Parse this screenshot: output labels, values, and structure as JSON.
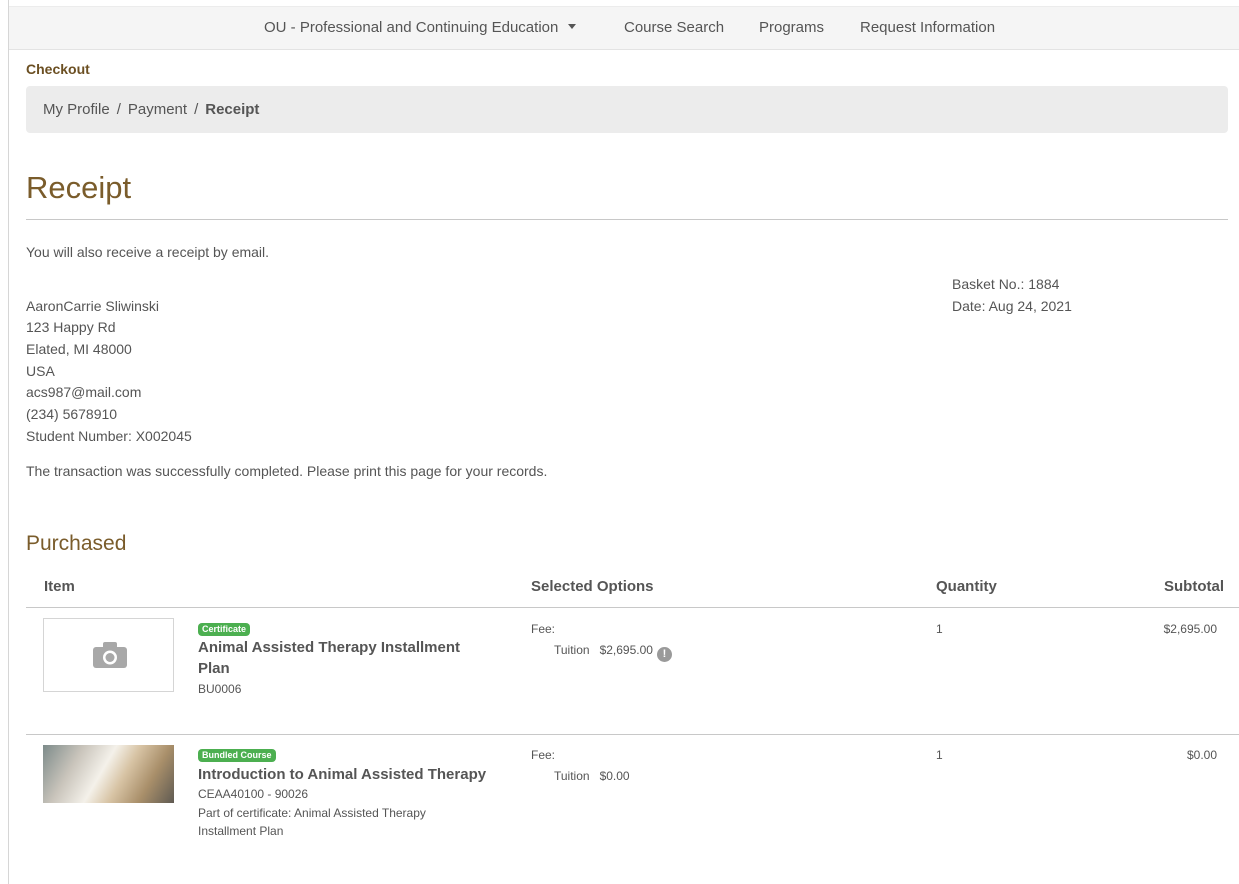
{
  "nav": {
    "brand": "OU - Professional and Continuing Education",
    "links": [
      "Course Search",
      "Programs",
      "Request Information"
    ]
  },
  "checkout_title": "Checkout",
  "breadcrumb": {
    "items": [
      "My Profile",
      "Payment"
    ],
    "separator": "/",
    "current": "Receipt"
  },
  "page_title": "Receipt",
  "email_note": "You will also receive a receipt by email.",
  "customer": {
    "name": "AaronCarrie Sliwinski",
    "street": "123 Happy Rd",
    "city_line": "Elated, MI 48000",
    "country": "USA",
    "email": "acs987@mail.com",
    "phone": "(234) 5678910",
    "student_number": "Student Number: X002045"
  },
  "basket": {
    "number": "Basket No.: 1884",
    "date": "Date: Aug 24, 2021"
  },
  "confirmation": "The transaction was successfully completed. Please print this page for your records.",
  "purchased": {
    "title": "Purchased",
    "columns": [
      "Item",
      "Selected Options",
      "Quantity",
      "Subtotal"
    ],
    "items": [
      {
        "badge": "Certificate",
        "badge_color": "#4caf50",
        "name_line1": "Animal Assisted Therapy Installment",
        "name_line2": "Plan",
        "code": "BU0006",
        "fee_label": "Fee:",
        "option_name": "Tuition",
        "option_price": "$2,695.00",
        "quantity": "1",
        "subtotal": "$2,695.00",
        "thumbnail_icon": "camera-icon"
      },
      {
        "badge": "Bundled Course",
        "badge_color": "#4caf50",
        "name_line1": "Introduction to Animal Assisted Therapy",
        "code": "CEAA40100 - 90026",
        "part_of_line1": "Part of certificate: Animal Assisted Therapy",
        "part_of_line2": "Installment Plan",
        "fee_label": "Fee:",
        "option_name": "Tuition",
        "option_price": "$0.00",
        "quantity": "1",
        "subtotal": "$0.00"
      }
    ]
  },
  "colors": {
    "heading_brown": "#7a5c2b",
    "checkout_brown": "#6b4f22",
    "badge_green": "#4caf50",
    "nav_bg": "#f5f5f5",
    "breadcrumb_bg": "#ececec"
  }
}
